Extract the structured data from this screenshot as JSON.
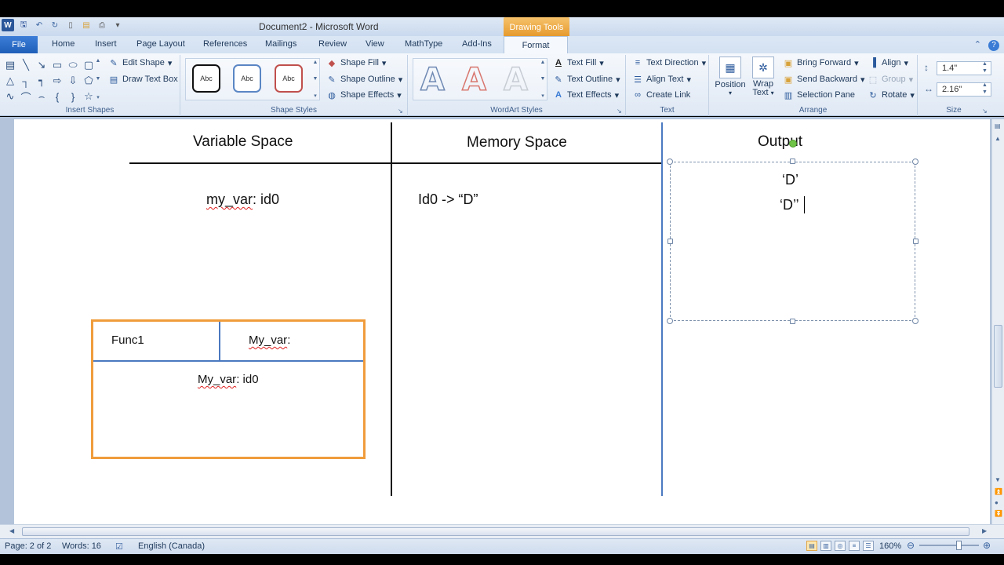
{
  "window": {
    "title": "Document2 - Microsoft Word",
    "contextual_tab_group": "Drawing Tools"
  },
  "tabs": {
    "file": "File",
    "items": [
      "Home",
      "Insert",
      "Page Layout",
      "References",
      "Mailings",
      "Review",
      "View",
      "MathType",
      "Add-Ins"
    ],
    "active": "Format"
  },
  "ribbon": {
    "insert_shapes": {
      "label": "Insert Shapes",
      "edit_shape": "Edit Shape",
      "draw_text_box": "Draw Text Box"
    },
    "shape_styles": {
      "label": "Shape Styles",
      "preset": "Abc",
      "shape_fill": "Shape Fill",
      "shape_outline": "Shape Outline",
      "shape_effects": "Shape Effects"
    },
    "wordart_styles": {
      "label": "WordArt Styles",
      "glyph": "A",
      "text_fill": "Text Fill",
      "text_outline": "Text Outline",
      "text_effects": "Text Effects"
    },
    "text": {
      "label": "Text",
      "text_direction": "Text Direction",
      "align_text": "Align Text",
      "create_link": "Create Link"
    },
    "arrange": {
      "label": "Arrange",
      "position": "Position",
      "wrap_text_line1": "Wrap",
      "wrap_text_line2": "Text",
      "bring_forward": "Bring Forward",
      "send_backward": "Send Backward",
      "selection_pane": "Selection Pane",
      "align": "Align",
      "group": "Group",
      "rotate": "Rotate"
    },
    "size": {
      "label": "Size",
      "height": "1.4\"",
      "width": "2.16\""
    }
  },
  "document": {
    "col1_heading": "Variable Space",
    "col2_heading": "Memory Space",
    "col3_heading": "Output",
    "var_entry_prefix": "my_var",
    "var_entry_suffix": ": id0",
    "memory_entry": "Id0 -> “D”",
    "output_line1": "‘D’",
    "output_line2": "‘D’’",
    "func_box": {
      "name": "Func1",
      "param_prefix": "My_var",
      "param_suffix": ":",
      "body_prefix": "My_var",
      "body_suffix": ": id0"
    }
  },
  "status_bar": {
    "page": "Page: 2 of 2",
    "words": "Words: 16",
    "language": "English (Canada)",
    "zoom": "160%"
  }
}
